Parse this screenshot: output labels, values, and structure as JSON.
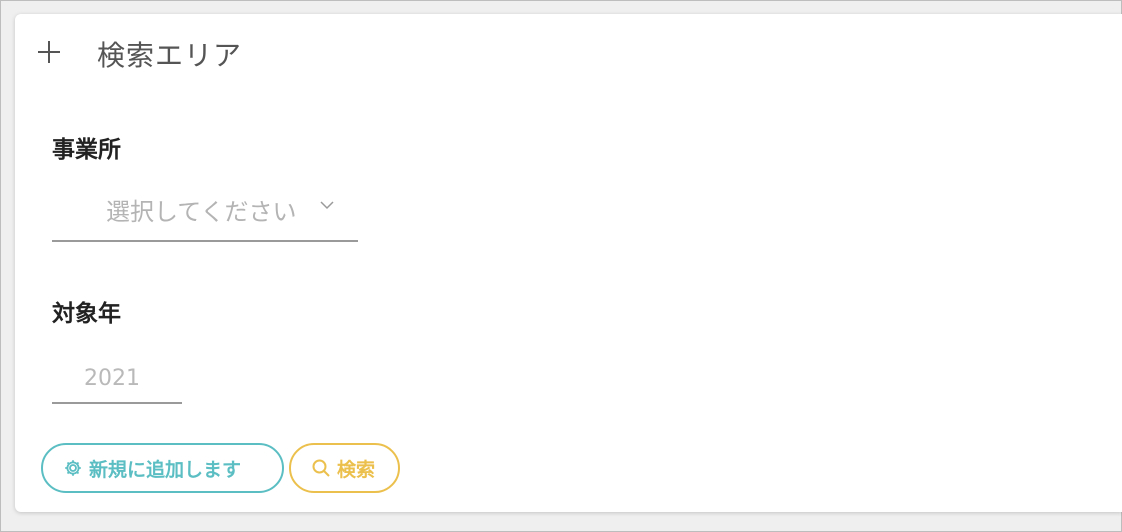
{
  "search_area": {
    "title": "検索エリア",
    "expand_icon": "plus-icon"
  },
  "office": {
    "label": "事業所",
    "select_placeholder": "選択してください",
    "dropdown_icon": "chevron-down-icon"
  },
  "year": {
    "label": "対象年",
    "placeholder": "2021"
  },
  "buttons": {
    "add_label": "新規に追加します",
    "add_icon": "gear-icon",
    "search_label": "検索",
    "search_icon": "search-icon"
  },
  "colors": {
    "add_accent": "#5bbec3",
    "search_accent": "#ecc04d",
    "title_text": "#555555",
    "placeholder_text": "#b4b4b4",
    "background": "#efefef"
  }
}
